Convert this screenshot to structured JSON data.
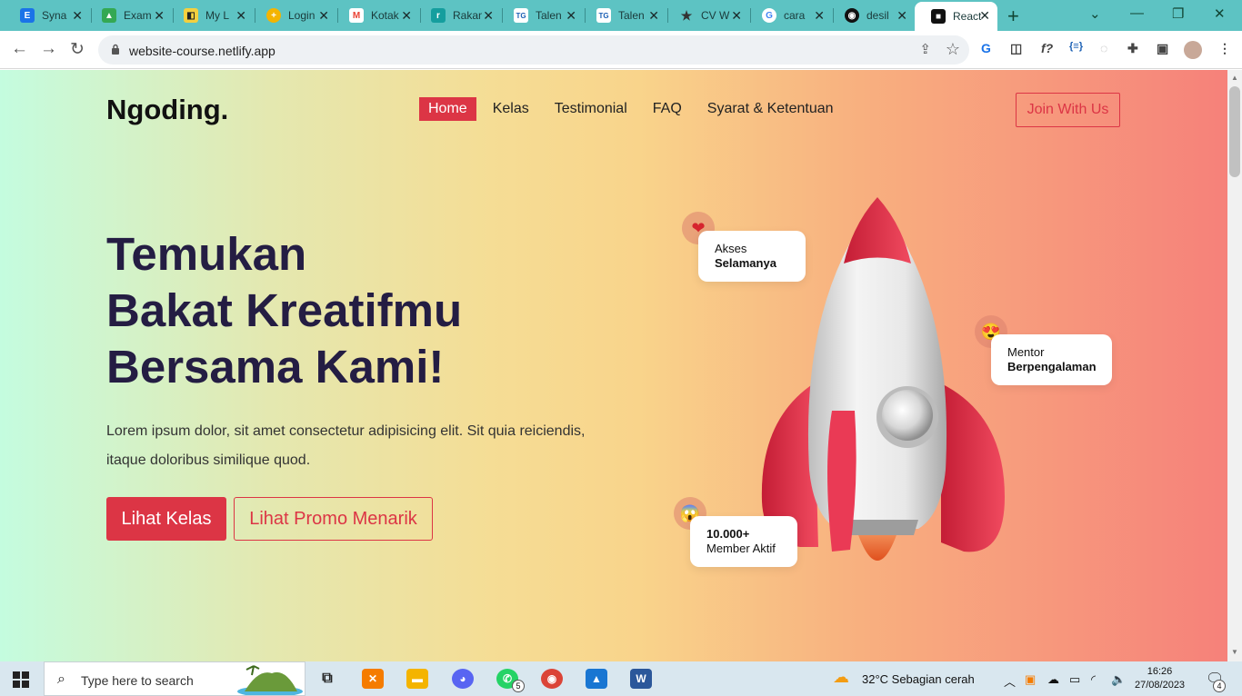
{
  "browser": {
    "tabs": [
      {
        "label": "Syna",
        "fav_icon": "element-icon",
        "fav_color": "#1a73e8",
        "fav_text": "E"
      },
      {
        "label": "Exam",
        "fav_icon": "google-drive-icon",
        "fav_color": "#34a853",
        "fav_text": "▲"
      },
      {
        "label": "My L",
        "fav_icon": "notebook-icon",
        "fav_color": "#f4d03f",
        "fav_text": "◧"
      },
      {
        "label": "Login",
        "fav_icon": "plus-circle-icon",
        "fav_color": "#f4b400",
        "fav_text": "+"
      },
      {
        "label": "Kotak",
        "fav_icon": "gmail-icon",
        "fav_color": "#ea4335",
        "fav_text": "M"
      },
      {
        "label": "Rakam",
        "fav_icon": "rakamin-icon",
        "fav_color": "#159e9e",
        "fav_text": "r"
      },
      {
        "label": "Talen",
        "fav_icon": "talent-icon",
        "fav_color": "#1a5fb4",
        "fav_text": "TG"
      },
      {
        "label": "Talen",
        "fav_icon": "talent-icon",
        "fav_color": "#1a5fb4",
        "fav_text": "TG"
      },
      {
        "label": "CV W",
        "fav_icon": "star-icon",
        "fav_color": "#333333",
        "fav_text": "★"
      },
      {
        "label": "cara",
        "fav_icon": "google-icon",
        "fav_color": "#4285f4",
        "fav_text": "G"
      },
      {
        "label": "desil",
        "fav_icon": "github-icon",
        "fav_color": "#111111",
        "fav_text": "◉"
      },
      {
        "label": "React",
        "fav_icon": "react-app-icon",
        "fav_color": "#111111",
        "fav_text": "■"
      }
    ],
    "url": "website-course.netlify.app"
  },
  "site": {
    "logo": "Ngoding.",
    "nav": [
      "Home",
      "Kelas",
      "Testimonial",
      "FAQ",
      "Syarat & Ketentuan"
    ],
    "join_button": "Join With Us",
    "hero_title": [
      "Temukan",
      "Bakat Kreatifmu",
      "Bersama Kami!"
    ],
    "hero_desc": "Lorem ipsum dolor, sit amet consectetur adipisicing elit. Sit quia reiciendis, itaque doloribus similique quod.",
    "primary_button": "Lihat Kelas",
    "secondary_button": "Lihat Promo Menarik",
    "badges": [
      {
        "line1": "Akses",
        "line2": "Selamanya",
        "emoji": "❤"
      },
      {
        "line1": "Mentor",
        "line2": "Berpengalaman",
        "emoji": "😍"
      },
      {
        "line1": "10.000+",
        "line2": "Member Aktif",
        "emoji": "😱"
      }
    ],
    "accent": "#dc3545",
    "title_color": "#241d43"
  },
  "taskbar": {
    "search_placeholder": "Type here to search",
    "weather": "32°C  Sebagian cerah",
    "time": "16:26",
    "date": "27/08/2023",
    "whatsapp_badge": "5",
    "notification_count": "4"
  }
}
